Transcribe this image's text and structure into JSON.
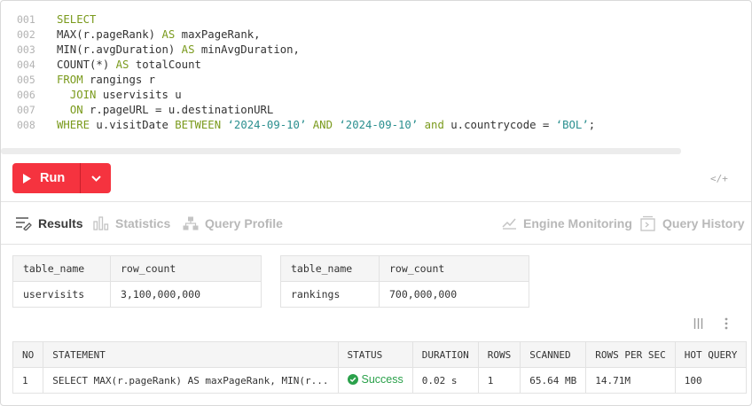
{
  "editor": {
    "lines": [
      {
        "n": "001",
        "parts": [
          {
            "t": "SELECT",
            "k": "kw"
          }
        ]
      },
      {
        "n": "002",
        "parts": [
          {
            "t": "MAX(r.pageRank) ",
            "k": ""
          },
          {
            "t": "AS",
            "k": "kw"
          },
          {
            "t": " maxPageRank,",
            "k": ""
          }
        ]
      },
      {
        "n": "003",
        "parts": [
          {
            "t": "MIN(r.avgDuration) ",
            "k": ""
          },
          {
            "t": "AS",
            "k": "kw"
          },
          {
            "t": " minAvgDuration,",
            "k": ""
          }
        ]
      },
      {
        "n": "004",
        "parts": [
          {
            "t": "COUNT(*) ",
            "k": ""
          },
          {
            "t": "AS",
            "k": "kw"
          },
          {
            "t": " totalCount",
            "k": ""
          }
        ]
      },
      {
        "n": "005",
        "parts": [
          {
            "t": "FROM",
            "k": "kw"
          },
          {
            "t": " rangings r",
            "k": ""
          }
        ]
      },
      {
        "n": "006",
        "parts": [
          {
            "t": "  ",
            "k": ""
          },
          {
            "t": "JOIN",
            "k": "kw"
          },
          {
            "t": " uservisits u",
            "k": ""
          }
        ]
      },
      {
        "n": "007",
        "parts": [
          {
            "t": "  ",
            "k": ""
          },
          {
            "t": "ON",
            "k": "kw"
          },
          {
            "t": " r.pageURL = u.destinationURL",
            "k": ""
          }
        ]
      },
      {
        "n": "008",
        "parts": [
          {
            "t": "WHERE",
            "k": "kw"
          },
          {
            "t": " u.visitDate ",
            "k": ""
          },
          {
            "t": "BETWEEN",
            "k": "kw"
          },
          {
            "t": " ",
            "k": ""
          },
          {
            "t": "‘2024-09-10’",
            "k": "str"
          },
          {
            "t": " ",
            "k": ""
          },
          {
            "t": "AND",
            "k": "kw"
          },
          {
            "t": " ",
            "k": ""
          },
          {
            "t": "‘2024-09-10’",
            "k": "str"
          },
          {
            "t": " ",
            "k": ""
          },
          {
            "t": "and",
            "k": "kw"
          },
          {
            "t": " u.countrycode = ",
            "k": ""
          },
          {
            "t": "‘BOL’",
            "k": "str"
          },
          {
            "t": ";",
            "k": ""
          }
        ]
      }
    ]
  },
  "toolbar": {
    "run_label": "Run",
    "code_toggle": "</+",
    "run_color": "#f5333f"
  },
  "tabs": {
    "results": "Results",
    "statistics": "Statistics",
    "query_profile": "Query Profile",
    "engine_monitoring": "Engine Monitoring",
    "query_history": "Query History"
  },
  "mini_tables": [
    {
      "headers": [
        "table_name",
        "row_count"
      ],
      "rows": [
        [
          "uservisits",
          "3,100,000,000"
        ]
      ]
    },
    {
      "headers": [
        "table_name",
        "row_count"
      ],
      "rows": [
        [
          "rankings",
          "700,000,000"
        ]
      ]
    }
  ],
  "history": {
    "headers": [
      "NO",
      "STATEMENT",
      "STATUS",
      "DURATION",
      "ROWS",
      "SCANNED",
      "ROWS PER SEC",
      "HOT QUERY"
    ],
    "rows": [
      [
        "1",
        "SELECT MAX(r.pageRank) AS maxPageRank, MIN(r...",
        "Success",
        "0.02 s",
        "1",
        "65.64 MB",
        "14.71M",
        "100"
      ]
    ]
  }
}
